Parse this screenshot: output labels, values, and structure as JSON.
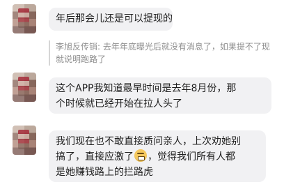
{
  "chat": {
    "messages": [
      {
        "text": "年后那会儿还是可以提现的"
      },
      {
        "quote": "李旭反传销: 去年年底曝光后就没有消息了，如果提不了现就说明跑路了"
      },
      {
        "line1": "这个APP我知道最早时间是去年8月份，那",
        "line2": "个时候就已经开始在拉人头了"
      },
      {
        "line1": "我们现在也不敢直接质问亲人，上次劝她别",
        "line2_before": "搞了，直接应激了",
        "line2_after": "，觉得我们所有人都",
        "line3": "是她赚钱路上的拦路虎",
        "emoji_name": "grimacing-face-icon"
      }
    ]
  }
}
